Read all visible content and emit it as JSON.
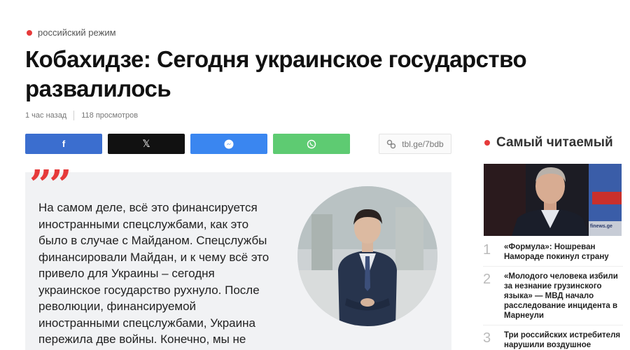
{
  "article": {
    "tag": "российский режим",
    "title": "Кобахидзе: Сегодня украинское государство развалилось",
    "time": "1 час назад",
    "views": "118 просмотров",
    "short_link": "tbl.ge/7bdb"
  },
  "share": {
    "facebook_icon": "f",
    "x_icon": "𝕏",
    "messenger_icon": "messenger-icon",
    "whatsapp_icon": "whatsapp-icon"
  },
  "quote": {
    "mark": "”",
    "lines": [
      "На самом деле, всё это финансируется",
      "иностранными спецслужбами, как это",
      "было в случае с Майданом. Спецслужбы",
      "финансировали Майдан, и к чему всё это",
      "привело для Украины – сегодня",
      "украинское государство рухнуло. После",
      "революции, финансируемой",
      "иностранными спецслужбами, Украина",
      "пережила две войны. Конечно, мы не"
    ]
  },
  "sidebar": {
    "title": "Самый читаемый",
    "photo_caption": "finews.ge",
    "items": [
      {
        "num": "1",
        "text": "«Формула»: Ношреван Намораде покинул страну"
      },
      {
        "num": "2",
        "text": "«Молодого человека избили за незнание грузинского языка» — МВД начало расследование инцидента в Марнеули"
      },
      {
        "num": "3",
        "text": "Три российских истребителя нарушили воздушное"
      }
    ]
  },
  "colors": {
    "accent": "#e63a3a",
    "facebook": "#3b6ecf",
    "x": "#111111",
    "messenger": "#3a86f0",
    "whatsapp": "#5ecb72",
    "quote_bg": "#f1f2f4"
  }
}
